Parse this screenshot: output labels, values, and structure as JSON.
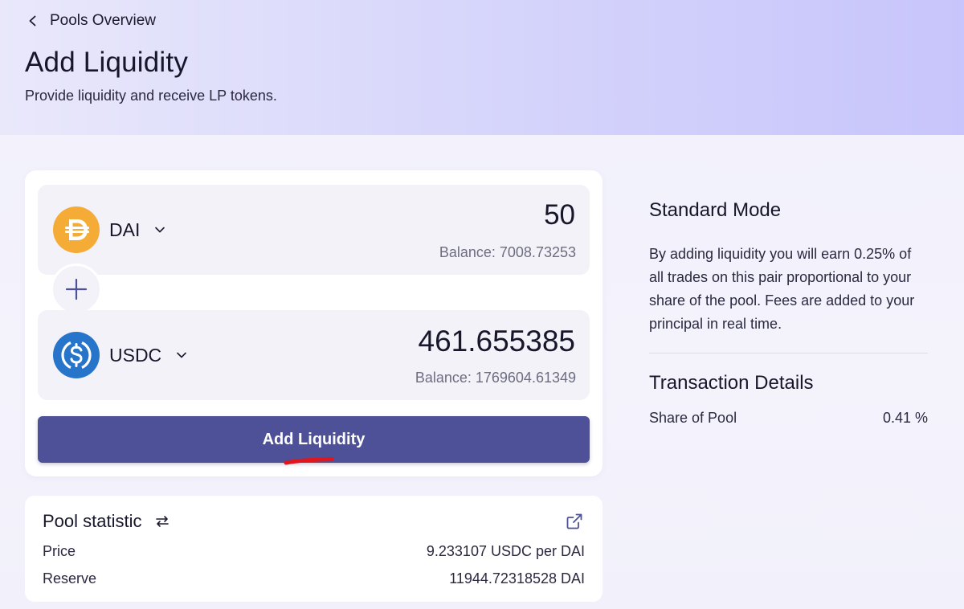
{
  "header": {
    "back_label": "Pools Overview",
    "title": "Add Liquidity",
    "subtitle": "Provide liquidity and receive LP tokens."
  },
  "token_a": {
    "symbol": "DAI",
    "amount": "50",
    "balance": "Balance: 7008.73253",
    "icon": "dai-logo-icon",
    "color": "#f5ac37"
  },
  "token_b": {
    "symbol": "USDC",
    "amount": "461.655385",
    "balance": "Balance: 1769604.61349",
    "icon": "usdc-logo-icon",
    "color": "#2775ca"
  },
  "action": {
    "add_liquidity_label": "Add Liquidity",
    "color": "#4e5197"
  },
  "pool_statistic": {
    "title": "Pool statistic",
    "rows": [
      {
        "label": "Price",
        "value": "9.233107 USDC per DAI"
      },
      {
        "label": "Reserve",
        "value": "11944.72318528 DAI"
      }
    ]
  },
  "info": {
    "mode_title": "Standard Mode",
    "mode_text": "By adding liquidity you will earn 0.25% of all trades on this pair proportional to your share of the pool. Fees are added to your principal in real time.",
    "tx_title": "Transaction Details",
    "tx_rows": [
      {
        "label": "Share of Pool",
        "value": "0.41 %"
      }
    ]
  }
}
